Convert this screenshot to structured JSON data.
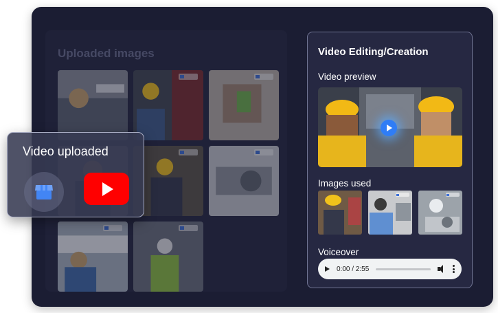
{
  "gallery": {
    "title": "Uploaded images"
  },
  "editor": {
    "title": "Video Editing/Creation",
    "preview_label": "Video preview",
    "images_label": "Images used",
    "voiceover_label": "Voiceover",
    "audio_time": "0:00 / 2:55"
  },
  "upload_popup": {
    "title": "Video uploaded"
  },
  "icons": {
    "store": "google-business-store-icon",
    "youtube": "youtube-play-icon",
    "play": "play-icon",
    "volume": "volume-icon",
    "menu": "more-vertical-icon"
  },
  "colors": {
    "frame": "#1b1d33",
    "panel": "#262842",
    "youtube": "#ff0000",
    "accent": "#2f7df6"
  }
}
